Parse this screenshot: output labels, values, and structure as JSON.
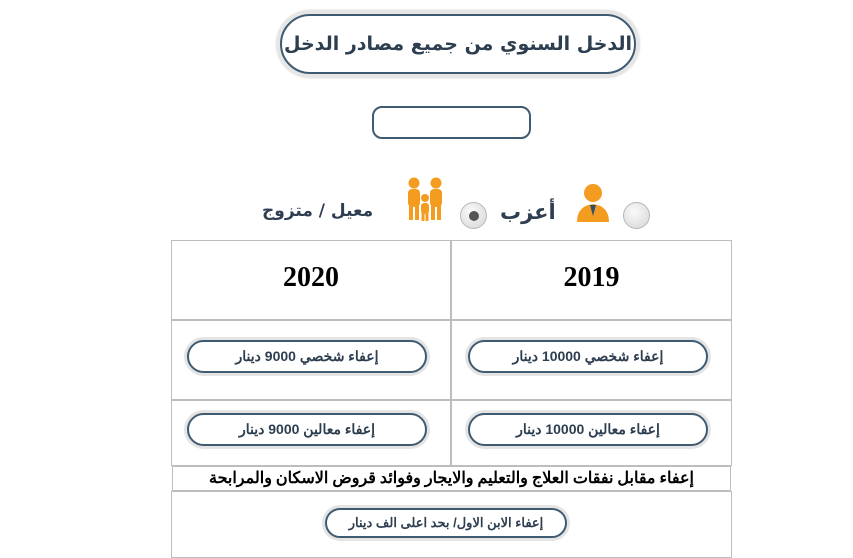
{
  "title": "الدخل السنوي من جميع مصادر الدخل",
  "income_input": {
    "value": ""
  },
  "status": {
    "single_label": "أعزب",
    "married_label": "معيل / متزوج",
    "selected": "married"
  },
  "years": {
    "right": "2019",
    "left": "2020"
  },
  "exemptions": {
    "personal_2019": "إعفاء شخصي 10000 دينار",
    "personal_2020": "إعفاء شخصي 9000 دينار",
    "dependents_2019": "إعفاء معالين 10000 دينار",
    "dependents_2020": "إعفاء معالين 9000 دينار"
  },
  "deductions_banner": "إعفاء مقابل نفقات العلاج والتعليم والايجار وفوائد قروض الاسكان والمرابحة",
  "first_child_button": "إعفاء الابن الاول/ بحد اعلى الف دينار",
  "colors": {
    "accent_orange": "#f39c1f",
    "border_navy": "#3f5b72"
  },
  "icons": {
    "single": "person-icon",
    "married": "family-icon"
  }
}
